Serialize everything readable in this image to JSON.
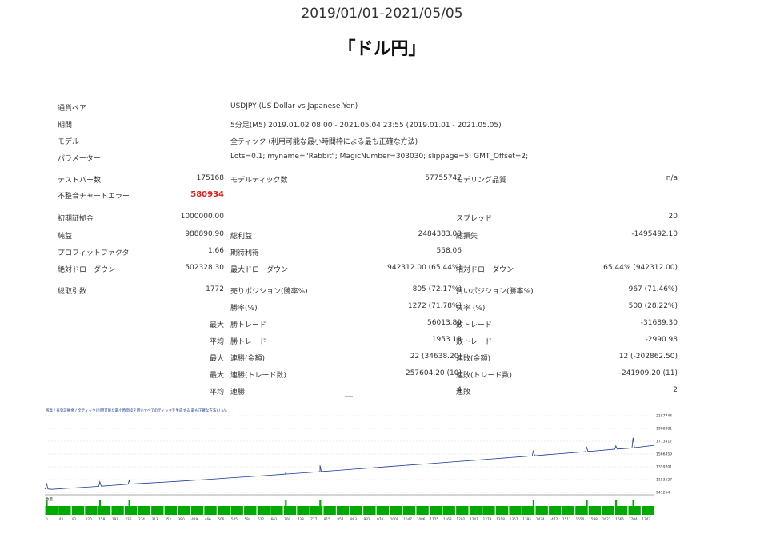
{
  "header": {
    "date_range": "2019/01/01-2021/05/05",
    "pair_title": "「ドル円」"
  },
  "report": {
    "currency_pair_label": "通貨ペア",
    "currency_pair_value": "USDJPY (US Dollar vs Japanese Yen)",
    "period_label": "期間",
    "period_value": "5分足(M5) 2019.01.02 08:00 - 2021.05.04 23:55 (2019.01.01 - 2021.05.05)",
    "model_label": "モデル",
    "model_value": "全ティック (利用可能な最小時間枠による最も正確な方法)",
    "params_label": "パラメーター",
    "params_value": "Lots=0.1; myname=\"Rabbit\"; MagicNumber=303030; slippage=5; GMT_Offset=2;",
    "test_bars_label": "テストバー数",
    "test_bars_value": "175168",
    "model_ticks_label": "モデルティック数",
    "model_ticks_value": "57755747",
    "model_quality_label": "モデリング品質",
    "model_quality_value": "n/a",
    "mismatch_label": "不整合チャートエラー",
    "mismatch_value": "580934",
    "initial_deposit_label": "初期証拠金",
    "initial_deposit_value": "1000000.00",
    "spread_label": "スプレッド",
    "spread_value": "20",
    "net_profit_label": "純益",
    "net_profit_value": "988890.90",
    "gross_profit_label": "総利益",
    "gross_profit_value": "2484383.00",
    "gross_loss_label": "総損失",
    "gross_loss_value": "-1495492.10",
    "profit_factor_label": "プロフィットファクタ",
    "profit_factor_value": "1.66",
    "expected_payoff_label": "期待利得",
    "expected_payoff_value": "558.06",
    "abs_drawdown_label": "絶対ドローダウン",
    "abs_drawdown_value": "502328.30",
    "max_drawdown_label": "最大ドローダウン",
    "max_drawdown_value": "942312.00 (65.44%)",
    "rel_drawdown_label": "相対ドローダウン",
    "rel_drawdown_value": "65.44% (942312.00)",
    "total_trades_label": "総取引数",
    "total_trades_value": "1772",
    "short_pos_label": "売りポジション(勝率%)",
    "short_pos_value": "805 (72.17%)",
    "long_pos_label": "買いポジション(勝率%)",
    "long_pos_value": "967 (71.46%)",
    "win_rate_label": "勝率(%)",
    "win_rate_value": "1272 (71.78%)",
    "loss_rate_label": "負率 (%)",
    "loss_rate_value": "500 (28.22%)",
    "max_label": "最大",
    "avg_label": "平均",
    "largest_win_label": "勝トレード",
    "largest_win_value": "56013.80",
    "largest_loss_label": "敗トレード",
    "largest_loss_value": "-31689.30",
    "avg_win_label": "勝トレード",
    "avg_win_value": "1953.13",
    "avg_loss_label": "敗トレード",
    "avg_loss_value": "-2990.98",
    "max_consec_wins_money_label": "連勝(金額)",
    "max_consec_wins_money_value": "22 (34638.20)",
    "max_consec_losses_money_label": "連敗(金額)",
    "max_consec_losses_money_value": "12 (-202862.50)",
    "max_consec_wins_trades_label": "連勝(トレード数)",
    "max_consec_wins_trades_value": "257604.20 (10)",
    "max_consec_losses_trades_label": "連敗(トレード数)",
    "max_consec_losses_trades_value": "-241909.20 (11)",
    "avg_consec_wins_label": "連勝",
    "avg_consec_wins_value": "4",
    "avg_consec_losses_label": "連敗",
    "avg_consec_losses_value": "2"
  },
  "chart_data": {
    "type": "line",
    "header_text": "残高 / 有効証拠金 / 全ティック(利用可能な最小時間枠を用いすべてのティックを生成する 最も正確な方法) / n/a",
    "volume_label": "数量",
    "y_ticks": [
      "2187744",
      "1988881",
      "1773417",
      "1566459",
      "1359701",
      "1153527",
      "941264"
    ],
    "ylim": [
      941264,
      2187744
    ],
    "x_ticks": [
      "0",
      "43",
      "81",
      "120",
      "158",
      "197",
      "236",
      "274",
      "313",
      "352",
      "390",
      "429",
      "466",
      "506",
      "545",
      "584",
      "622",
      "661",
      "700",
      "738",
      "777",
      "815",
      "854",
      "893",
      "931",
      "970",
      "1009",
      "1047",
      "1086",
      "1125",
      "1163",
      "1202",
      "1241",
      "1279",
      "1318",
      "1357",
      "1395",
      "1434",
      "1472",
      "1511",
      "1550",
      "1588",
      "1627",
      "1666",
      "1704",
      "1743"
    ],
    "x": [
      0,
      20,
      60,
      100,
      150,
      200,
      250,
      300,
      350,
      400,
      450,
      500,
      550,
      600,
      650,
      700,
      750,
      800,
      850,
      900,
      950,
      1000,
      1050,
      1100,
      1150,
      1200,
      1250,
      1300,
      1350,
      1400,
      1450,
      1500,
      1550,
      1600,
      1650,
      1700,
      1772
    ],
    "balance": [
      1000000,
      990000,
      1005000,
      1018000,
      1035000,
      1055000,
      1075000,
      1090000,
      1105000,
      1122000,
      1140000,
      1158000,
      1176000,
      1195000,
      1214000,
      1232000,
      1252000,
      1272000,
      1291000,
      1311000,
      1330000,
      1352000,
      1372000,
      1392000,
      1412000,
      1432000,
      1452000,
      1474000,
      1495000,
      1516000,
      1536000,
      1558000,
      1580000,
      1602000,
      1625000,
      1645000,
      1690000
    ],
    "spikes_x": [
      5,
      160,
      245,
      700,
      800,
      1420,
      1575,
      1660,
      1710
    ],
    "spikes_y": [
      1090000,
      1110000,
      1130000,
      1250000,
      1370000,
      1600000,
      1660000,
      1680000,
      1810000
    ],
    "colors": {
      "balance": "#1a3a9a",
      "volume": "#00aa00",
      "grid": "#d8d8d8",
      "header": "#1a3a9a"
    }
  }
}
